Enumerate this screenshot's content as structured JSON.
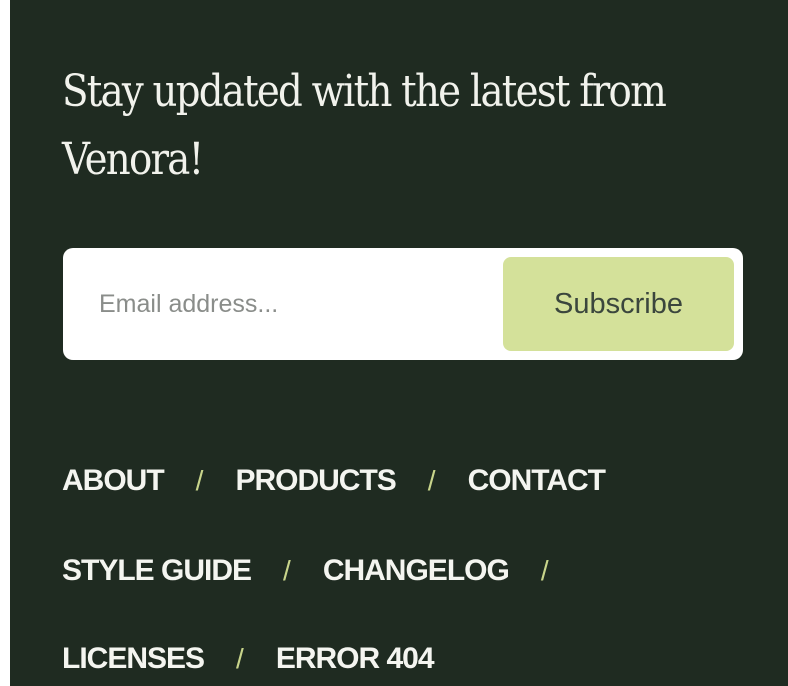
{
  "newsletter": {
    "heading": "Stay updated with the latest from Venora!",
    "email_placeholder": "Email address...",
    "email_value": "",
    "subscribe_label": "Subscribe"
  },
  "footer_nav": {
    "separator": "/",
    "rows": [
      [
        {
          "label": "ABOUT"
        },
        {
          "label": "PRODUCTS"
        },
        {
          "label": "CONTACT"
        }
      ],
      [
        {
          "label": "STYLE GUIDE"
        },
        {
          "label": "CHANGELOG"
        }
      ],
      [
        {
          "label": "LICENSES"
        },
        {
          "label": "ERROR 404"
        }
      ]
    ]
  },
  "colors": {
    "background": "#1f2b21",
    "heading_text": "#f1f2ec",
    "button_bg": "#d4e19a",
    "button_text": "#3b463d",
    "separator": "#c8d58b",
    "input_bg": "#ffffff"
  }
}
